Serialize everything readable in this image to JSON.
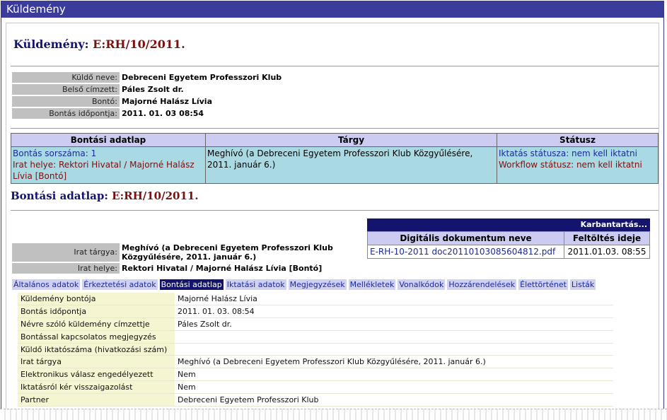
{
  "window": {
    "title": "Küldemény"
  },
  "header": {
    "label": "Küldemény:",
    "id": "E:RH/10/2011."
  },
  "sender_info": [
    {
      "label": "Küldő neve:",
      "value": "Debreceni Egyetem Professzori Klub"
    },
    {
      "label": "Belső címzett:",
      "value": "Páles Zsolt dr."
    },
    {
      "label": "Bontó:",
      "value": "Majorné Halász Lívia"
    },
    {
      "label": "Bontás időpontja:",
      "value": "2011. 01. 03 08:54"
    }
  ],
  "summary": {
    "headers": [
      "Bontási adatlap",
      "Tárgy",
      "Státusz"
    ],
    "bontas_sorszama": "Bontás sorszáma: 1",
    "irat_helye": "Irat helye: Rektori Hivatal / Majorné Halász Lívia [Bontó]",
    "targy": "Meghívó (a Debreceni Egyetem Professzori Klub Közgyűlésére, 2011. január 6.)",
    "iktatas_status": "Iktatás státusza: nem kell iktatni",
    "workflow_status": "Workflow státusz: nem kell iktatni"
  },
  "section2": {
    "label": "Bontási adatlap:",
    "id": "E:RH/10/2011."
  },
  "doc_info": [
    {
      "label": "Irat tárgya:",
      "value": "Meghívó (a Debreceni Egyetem Professzori Klub Közgyűlésére, 2011. január 6.)"
    },
    {
      "label": "Irat helye:",
      "value": "Rektori Hivatal / Majorné Halász Lívia [Bontó]"
    }
  ],
  "documents": {
    "action": "Karbantartás...",
    "headers": [
      "Digitális dokumentum neve",
      "Feltöltés ideje"
    ],
    "rows": [
      {
        "name": "E-RH-10-2011 doc20110103085604812.pdf",
        "uploaded": "2011.01.03. 08:55"
      }
    ]
  },
  "tabs": [
    "Általános adatok",
    "Érkeztetési adatok",
    "Bontási adatlap",
    "Iktatási adatok",
    "Megjegyzések",
    "Mellékletek",
    "Vonalkódok",
    "Hozzárendelések",
    "Élettörténet",
    "Listák"
  ],
  "active_tab": "Bontási adatlap",
  "details": [
    {
      "label": "Küldemény bontója",
      "value": "Majorné Halász Lívia"
    },
    {
      "label": "Bontás időpontja",
      "value": "2011. 01. 03. 08:54"
    },
    {
      "label": "Névre szóló küldemény címzettje",
      "value": "Páles Zsolt dr."
    },
    {
      "label": "Bontással kapcsolatos megjegyzés",
      "value": ""
    },
    {
      "label": "Küldő iktatószáma (hivatkozási szám)",
      "value": ""
    },
    {
      "label": "Irat tárgya",
      "value": "Meghívó (a Debreceni Egyetem Professzori Klub Közgyűlésére, 2011. január 6.)"
    },
    {
      "label": "Elektronikus válasz engedélyezett",
      "value": "Nem"
    },
    {
      "label": "Iktatásról kér visszaigazolást",
      "value": "Nem"
    },
    {
      "label": "Partner",
      "value": "Debreceni Egyetem Professzori Klub"
    }
  ]
}
